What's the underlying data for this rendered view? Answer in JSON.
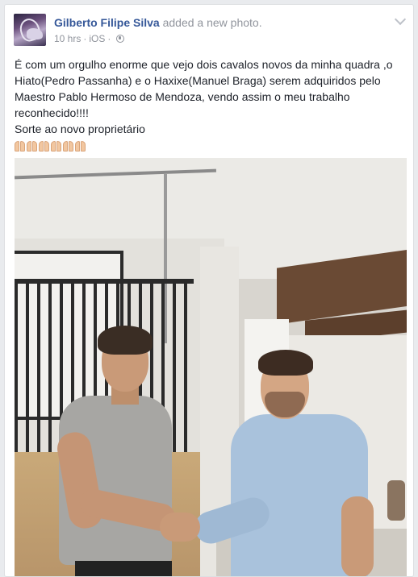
{
  "post": {
    "author": "Gilberto Filipe Silva",
    "action": "added a new photo.",
    "time": "10 hrs",
    "separator": "·",
    "source": "iOS",
    "audience_icon": "globe-icon",
    "menu_icon": "chevron-down-icon",
    "text_line1": "É com um orgulho enorme que vejo dois cavalos novos da minha quadra ,o Hiato(Pedro Passanha) e o Haxixe(Manuel Braga) serem adquiridos pelo Maestro Pablo Hermoso de Mendoza, vendo assim o meu trabalho reconhecido!!!!",
    "text_line2": "Sorte ao novo proprietário",
    "emoji_count": 6,
    "emoji_icon": "folded-hands-emoji"
  },
  "colors": {
    "link": "#365899",
    "meta": "#90949c",
    "text": "#1d2129",
    "background": "#e9ebee"
  }
}
